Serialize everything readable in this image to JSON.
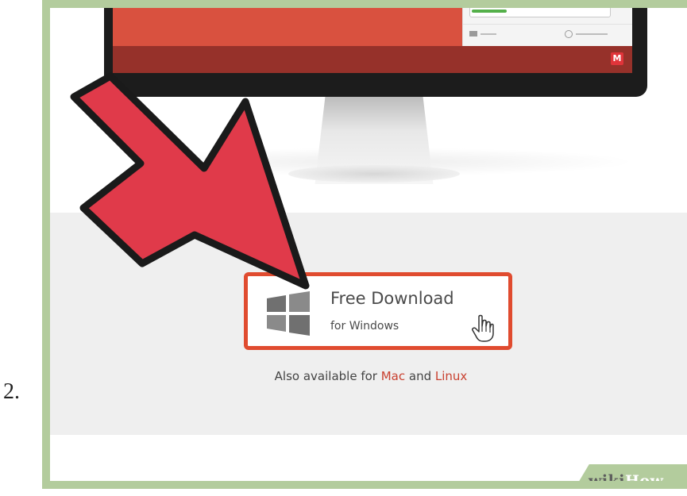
{
  "step": {
    "number": "2."
  },
  "monitor": {
    "logo_letter": "M",
    "screen_color": "#d9513f",
    "screen_dark_color": "#96312a"
  },
  "download": {
    "title": "Free Download",
    "subtitle": "for Windows",
    "border_color": "#e04b2f",
    "icon": "windows-logo-icon",
    "cursor_icon": "hand-pointer-icon"
  },
  "availability": {
    "prefix": "Also available for ",
    "mac": "Mac",
    "and": " and ",
    "linux": "Linux",
    "link_color": "#c94130"
  },
  "arrow": {
    "icon": "red-arrow-icon",
    "color": "#e03a4a"
  },
  "watermark": {
    "wiki": "wiki",
    "how": "How",
    "color": "#b3cc9d"
  }
}
